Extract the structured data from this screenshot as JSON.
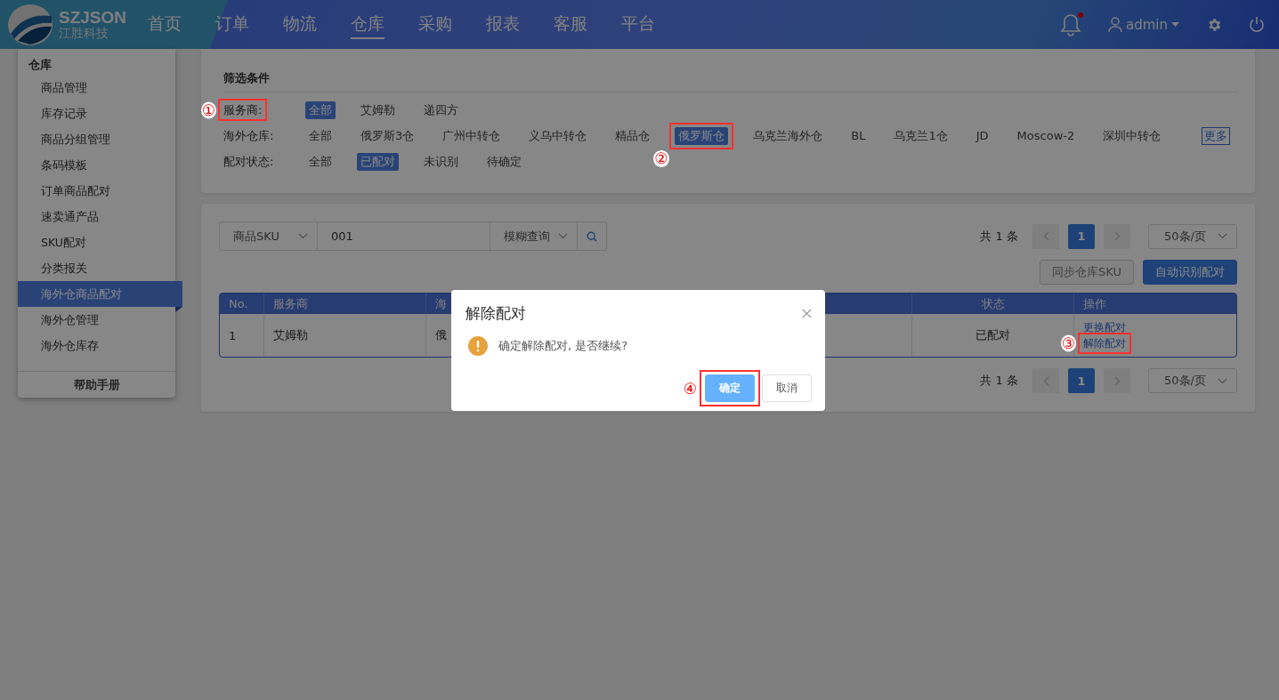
{
  "header": {
    "logo": {
      "name": "SZJSON",
      "subtitle": "江胜科技"
    },
    "nav": [
      {
        "label": "首页",
        "selected": false
      },
      {
        "label": "订单",
        "selected": false
      },
      {
        "label": "物流",
        "selected": false
      },
      {
        "label": "仓库",
        "selected": true
      },
      {
        "label": "采购",
        "selected": false
      },
      {
        "label": "报表",
        "selected": false
      },
      {
        "label": "客服",
        "selected": false
      },
      {
        "label": "平台",
        "selected": false
      }
    ],
    "notifications": {
      "unread": true
    },
    "user": "admin"
  },
  "sidebar": {
    "title": "仓库",
    "items": [
      {
        "label": "商品管理",
        "selected": false
      },
      {
        "label": "库存记录",
        "selected": false
      },
      {
        "label": "商品分组管理",
        "selected": false
      },
      {
        "label": "条码模板",
        "selected": false
      },
      {
        "label": "订单商品配对",
        "selected": false
      },
      {
        "label": "速卖通产品",
        "selected": false
      },
      {
        "label": "SKU配对",
        "selected": false
      },
      {
        "label": "分类报关",
        "selected": false
      },
      {
        "label": "海外仓商品配对",
        "selected": true
      },
      {
        "label": "海外仓管理",
        "selected": false
      },
      {
        "label": "海外仓库存",
        "selected": false
      }
    ],
    "help": "帮助手册"
  },
  "filters": {
    "title": "筛选条件",
    "rows": [
      {
        "label": "服务商:",
        "annotation": "①",
        "options": [
          {
            "label": "全部",
            "selected": true
          },
          {
            "label": "艾姆勒",
            "selected": false
          },
          {
            "label": "递四方",
            "selected": false
          }
        ]
      },
      {
        "label": "海外仓库:",
        "more": "更多",
        "options": [
          {
            "label": "全部",
            "selected": false
          },
          {
            "label": "俄罗斯3仓",
            "selected": false
          },
          {
            "label": "广州中转仓",
            "selected": false
          },
          {
            "label": "义乌中转仓",
            "selected": false
          },
          {
            "label": "精品仓",
            "selected": false
          },
          {
            "label": "俄罗斯仓",
            "selected": true,
            "annotation": "②"
          },
          {
            "label": "乌克兰海外仓",
            "selected": false
          },
          {
            "label": "BL",
            "selected": false
          },
          {
            "label": "乌克兰1仓",
            "selected": false
          },
          {
            "label": "JD",
            "selected": false
          },
          {
            "label": "Moscow-2",
            "selected": false
          },
          {
            "label": "深圳中转仓",
            "selected": false
          }
        ]
      },
      {
        "label": "配对状态:",
        "options": [
          {
            "label": "全部",
            "selected": false
          },
          {
            "label": "已配对",
            "selected": true
          },
          {
            "label": "未识别",
            "selected": false
          },
          {
            "label": "待确定",
            "selected": false
          }
        ]
      }
    ]
  },
  "search": {
    "field": "商品SKU",
    "value": "001",
    "mode": "模糊查询"
  },
  "pagination_top": {
    "total": "共 1 条",
    "page": "1",
    "page_size": "50条/页"
  },
  "actions": [
    {
      "label": "同步仓库SKU",
      "kind": "secondary"
    },
    {
      "label": "自动识别配对",
      "kind": "primary"
    }
  ],
  "table": {
    "columns": [
      "No.",
      "服务商",
      "海",
      "状态",
      "操作"
    ],
    "rows": [
      {
        "cells": [
          "1",
          "艾姆勒",
          "俄",
          "已配对"
        ],
        "actions": [
          {
            "label": "更换配对"
          },
          {
            "label": "解除配对",
            "annotation": "③"
          }
        ]
      }
    ]
  },
  "pagination_bottom": {
    "total": "共 1 条",
    "page": "1",
    "page_size": "50条/页"
  },
  "dialog": {
    "title": "解除配对",
    "message": "确定解除配对, 是否继续?",
    "buttons": [
      {
        "label": "确定",
        "kind": "primary",
        "annotation": "④"
      },
      {
        "label": "取消",
        "kind": "secondary"
      }
    ]
  }
}
